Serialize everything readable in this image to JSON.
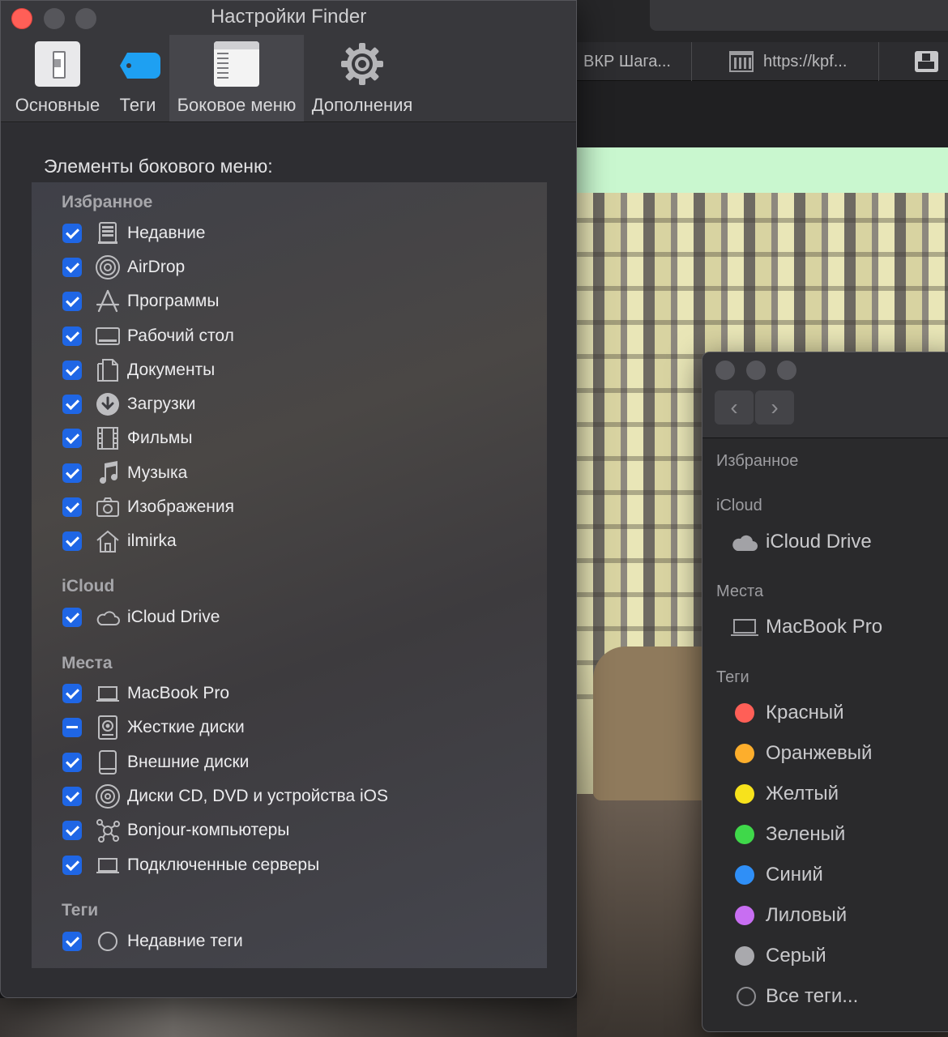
{
  "browser": {
    "tabs": [
      {
        "label": "ВКР Шага..."
      },
      {
        "label": "https://kpf...",
        "icon": "bank-icon"
      },
      {
        "icon": "grid-icon"
      }
    ]
  },
  "prefs": {
    "title": "Настройки Finder",
    "toolbar": [
      {
        "label": "Основные",
        "icon": "switch-icon"
      },
      {
        "label": "Теги",
        "icon": "tag-icon"
      },
      {
        "label": "Боковое меню",
        "icon": "sidebar-icon",
        "active": true
      },
      {
        "label": "Дополнения",
        "icon": "gear-icon"
      }
    ],
    "heading": "Элементы бокового меню:",
    "sections": [
      {
        "title": "Избранное",
        "items": [
          {
            "label": "Недавние",
            "icon": "recents-icon",
            "state": "checked"
          },
          {
            "label": "AirDrop",
            "icon": "airdrop-icon",
            "state": "checked"
          },
          {
            "label": "Программы",
            "icon": "applications-icon",
            "state": "checked"
          },
          {
            "label": "Рабочий стол",
            "icon": "desktop-icon",
            "state": "checked"
          },
          {
            "label": "Документы",
            "icon": "documents-icon",
            "state": "checked"
          },
          {
            "label": "Загрузки",
            "icon": "downloads-icon",
            "state": "checked"
          },
          {
            "label": "Фильмы",
            "icon": "movies-icon",
            "state": "checked"
          },
          {
            "label": "Музыка",
            "icon": "music-icon",
            "state": "checked"
          },
          {
            "label": "Изображения",
            "icon": "camera-icon",
            "state": "checked"
          },
          {
            "label": "ilmirka",
            "icon": "home-icon",
            "state": "checked"
          }
        ]
      },
      {
        "title": "iCloud",
        "items": [
          {
            "label": "iCloud Drive",
            "icon": "cloud-icon",
            "state": "checked"
          }
        ]
      },
      {
        "title": "Места",
        "items": [
          {
            "label": "MacBook Pro",
            "icon": "laptop-icon",
            "state": "checked"
          },
          {
            "label": "Жесткие диски",
            "icon": "hard-disk-icon",
            "state": "mixed"
          },
          {
            "label": "Внешние диски",
            "icon": "external-disk-icon",
            "state": "checked"
          },
          {
            "label": "Диски CD, DVD и устройства iOS",
            "icon": "cd-icon",
            "state": "checked"
          },
          {
            "label": "Bonjour-компьютеры",
            "icon": "bonjour-icon",
            "state": "checked"
          },
          {
            "label": "Подключенные серверы",
            "icon": "server-icon",
            "state": "checked"
          }
        ]
      },
      {
        "title": "Теги",
        "items": [
          {
            "label": "Недавние теги",
            "icon": "recent-tags-icon",
            "state": "checked"
          }
        ]
      }
    ]
  },
  "finder": {
    "nav": {
      "back": "‹",
      "forward": "›"
    },
    "sections": {
      "favorites": "Избранное",
      "icloud": "iCloud",
      "icloud_drive": "iCloud Drive",
      "places": "Места",
      "macbook": "MacBook Pro",
      "tags": "Теги"
    },
    "tags": [
      {
        "label": "Красный",
        "color": "#ff5f57"
      },
      {
        "label": "Оранжевый",
        "color": "#fdae2c"
      },
      {
        "label": "Желтый",
        "color": "#f7e21c"
      },
      {
        "label": "Зеленый",
        "color": "#3fd84a"
      },
      {
        "label": "Синий",
        "color": "#2f8ff7"
      },
      {
        "label": "Лиловый",
        "color": "#c86ef2"
      },
      {
        "label": "Серый",
        "color": "#a9a9ad"
      }
    ],
    "all_tags": "Все теги..."
  }
}
